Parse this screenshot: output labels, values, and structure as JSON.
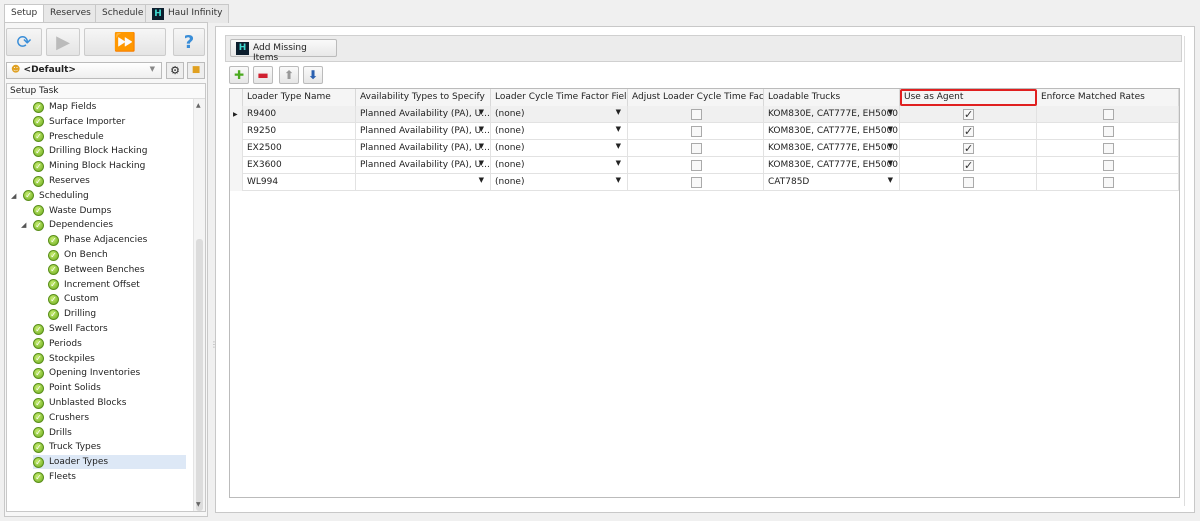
{
  "tabs": [
    "Setup",
    "Reserves",
    "Schedule",
    "Haul Infinity"
  ],
  "scenario": "<Default>",
  "tree": {
    "header": "Setup Task",
    "items": [
      {
        "label": "Map Fields",
        "level": 1
      },
      {
        "label": "Surface Importer",
        "level": 1
      },
      {
        "label": "Preschedule",
        "level": 1
      },
      {
        "label": "Drilling Block Hacking",
        "level": 1
      },
      {
        "label": "Mining Block Hacking",
        "level": 1
      },
      {
        "label": "Reserves",
        "level": 1
      },
      {
        "label": "Scheduling",
        "level": 0,
        "expanded": true
      },
      {
        "label": "Waste Dumps",
        "level": 1
      },
      {
        "label": "Dependencies",
        "level": 1,
        "expanded": true
      },
      {
        "label": "Phase Adjacencies",
        "level": 2
      },
      {
        "label": "On Bench",
        "level": 2
      },
      {
        "label": "Between Benches",
        "level": 2
      },
      {
        "label": "Increment Offset",
        "level": 2
      },
      {
        "label": "Custom",
        "level": 2
      },
      {
        "label": "Drilling",
        "level": 2
      },
      {
        "label": "Swell Factors",
        "level": 1
      },
      {
        "label": "Periods",
        "level": 1
      },
      {
        "label": "Stockpiles",
        "level": 1
      },
      {
        "label": "Opening Inventories",
        "level": 1
      },
      {
        "label": "Point Solids",
        "level": 1
      },
      {
        "label": "Unblasted Blocks",
        "level": 1
      },
      {
        "label": "Crushers",
        "level": 1
      },
      {
        "label": "Drills",
        "level": 1
      },
      {
        "label": "Truck Types",
        "level": 1
      },
      {
        "label": "Loader Types",
        "level": 1,
        "selected": true
      },
      {
        "label": "Fleets",
        "level": 1
      }
    ]
  },
  "add_missing": "Add Missing Items",
  "grid": {
    "columns": [
      "Loader Type Name",
      "Availability Types to Specify",
      "Loader Cycle Time Factor Field",
      "Adjust Loader Cycle Time Fact...",
      "Loadable Trucks",
      "Use as Agent",
      "Enforce Matched Rates"
    ],
    "rows": [
      {
        "name": "R9400",
        "avail": "Planned Availability (PA), U...",
        "cycle": "(none)",
        "adjust": false,
        "trucks": "KOM830E, CAT777E, EH5000",
        "agent": true,
        "enforce": false
      },
      {
        "name": "R9250",
        "avail": "Planned Availability (PA), U...",
        "cycle": "(none)",
        "adjust": false,
        "trucks": "KOM830E, CAT777E, EH5000",
        "agent": true,
        "enforce": false
      },
      {
        "name": "EX2500",
        "avail": "Planned Availability (PA), U...",
        "cycle": "(none)",
        "adjust": false,
        "trucks": "KOM830E, CAT777E, EH5000",
        "agent": true,
        "enforce": false
      },
      {
        "name": "EX3600",
        "avail": "Planned Availability (PA), U...",
        "cycle": "(none)",
        "adjust": false,
        "trucks": "KOM830E, CAT777E, EH5000",
        "agent": true,
        "enforce": false
      },
      {
        "name": "WL994",
        "avail": "",
        "cycle": "(none)",
        "adjust": false,
        "trucks": "CAT785D",
        "agent": false,
        "enforce": false
      }
    ]
  },
  "highlight_color": "#e02020"
}
